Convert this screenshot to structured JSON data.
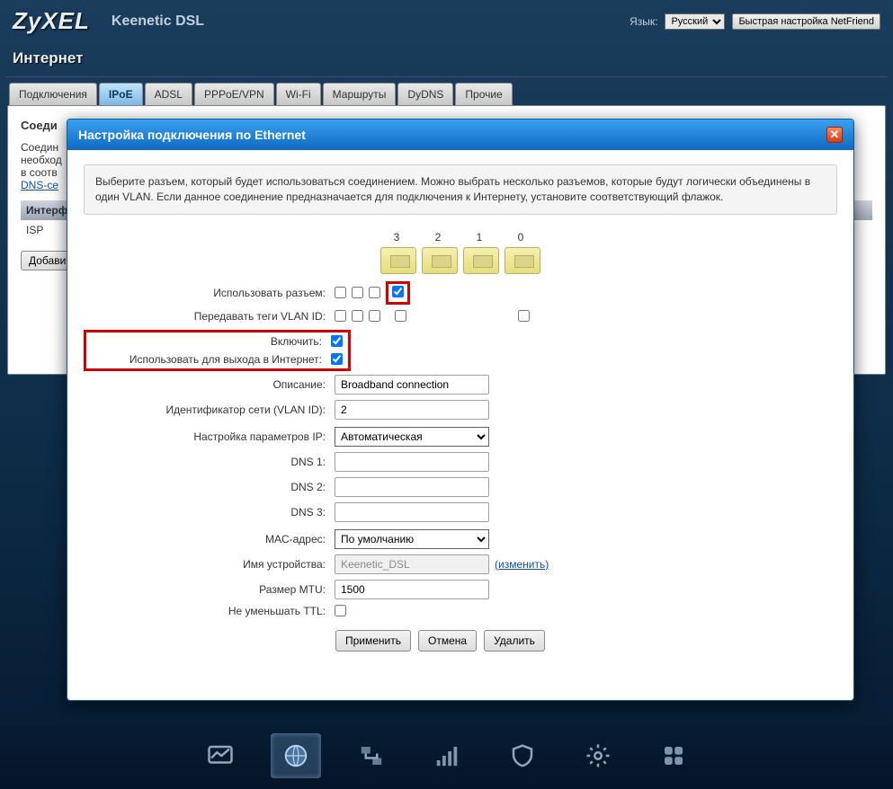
{
  "header": {
    "logo": "ZyXEL",
    "device": "Keenetic DSL",
    "lang_label": "Язык:",
    "lang_value": "Русский",
    "netfriend": "Быстрая настройка NetFriend"
  },
  "section_title": "Интернет",
  "tabs": [
    "Подключения",
    "IPoE",
    "ADSL",
    "PPPoE/VPN",
    "Wi-Fi",
    "Маршруты",
    "DyDNS",
    "Прочие"
  ],
  "active_tab": "IPoE",
  "back_panel": {
    "subtitle": "Соеди",
    "hint_p1": "Соедин",
    "hint_p2": "необход",
    "hint_p3": "в соотв",
    "link": "DNS-се",
    "th": "Интерф",
    "row1": "ISP",
    "add": "Добави"
  },
  "modal": {
    "title": "Настройка подключения по Ethernet",
    "help": "Выберите разъем, который будет использоваться соединением. Можно выбрать несколько разъемов, которые будут логически объединены в один VLAN. Если данное соединение предназначается для подключения к Интернету, установите соответствующий флажок.",
    "ports": [
      "3",
      "2",
      "1",
      "0"
    ],
    "labels": {
      "use_port": "Использовать разъем:",
      "vlan_tags": "Передавать теги VLAN ID:",
      "enable": "Включить:",
      "use_internet": "Использовать для выхода в Интернет:",
      "desc": "Описание:",
      "vlan_id": "Идентификатор сети (VLAN ID):",
      "ip_cfg": "Настройка параметров IP:",
      "dns1": "DNS 1:",
      "dns2": "DNS 2:",
      "dns3": "DNS 3:",
      "mac": "MAC-адрес:",
      "devname": "Имя устройства:",
      "mtu": "Размер MTU:",
      "ttl": "Не уменьшать TTL:"
    },
    "values": {
      "use_port": [
        false,
        false,
        false,
        true
      ],
      "vlan_tags": [
        false,
        false,
        false,
        false
      ],
      "vlan_extra": false,
      "enable": true,
      "use_internet": true,
      "desc": "Broadband connection",
      "vlan_id": "2",
      "ip_cfg": "Автоматическая",
      "dns1": "",
      "dns2": "",
      "dns3": "",
      "mac": "По умолчанию",
      "devname": "Keenetic_DSL",
      "devname_change": "(изменить)",
      "mtu": "1500",
      "ttl": false
    },
    "buttons": {
      "apply": "Применить",
      "cancel": "Отмена",
      "delete": "Удалить"
    }
  },
  "dock": [
    "monitor-icon",
    "globe-icon",
    "network-icon",
    "signal-icon",
    "shield-icon",
    "gear-icon",
    "apps-icon"
  ]
}
